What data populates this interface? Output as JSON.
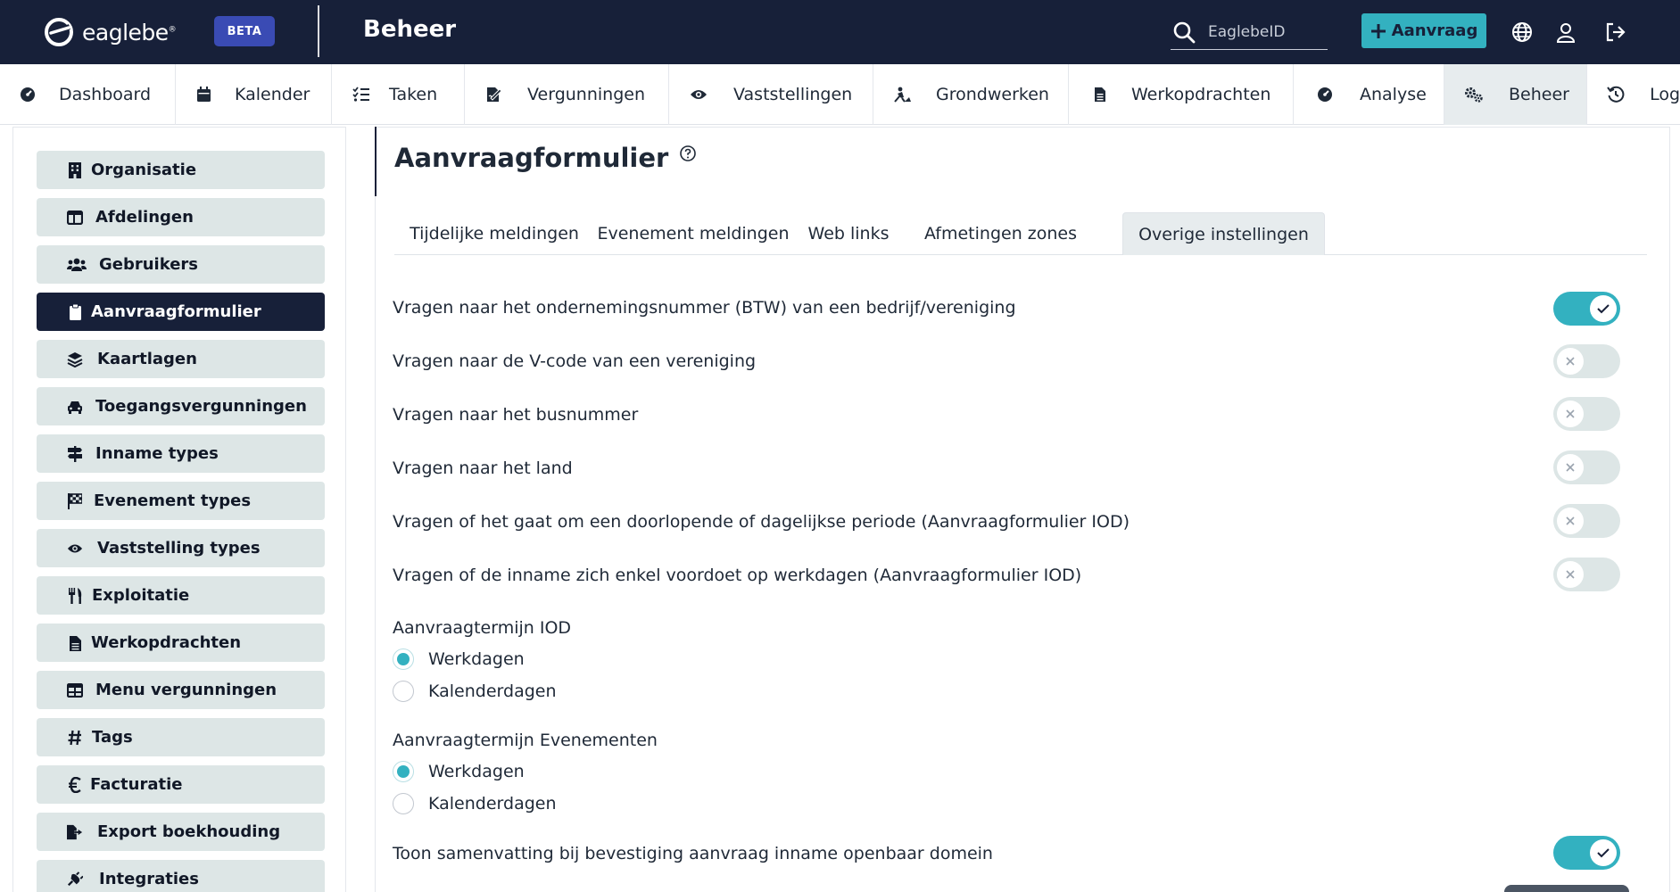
{
  "header": {
    "brand": "eaglebe",
    "brand_mark": "®",
    "beta_badge": "BETA",
    "section_title": "Beheer",
    "search_placeholder": "EaglebeID",
    "new_request_label": "Aanvraag"
  },
  "nav": {
    "items": [
      {
        "label": "Dashboard",
        "icon": "gauge-icon"
      },
      {
        "label": "Kalender",
        "icon": "calendar-icon"
      },
      {
        "label": "Taken",
        "icon": "tasks-icon"
      },
      {
        "label": "Vergunningen",
        "icon": "signature-icon"
      },
      {
        "label": "Vaststellingen",
        "icon": "eye-icon"
      },
      {
        "label": "Grondwerken",
        "icon": "digging-icon"
      },
      {
        "label": "Werkopdrachten",
        "icon": "file-icon"
      },
      {
        "label": "Analyse",
        "icon": "gauge-icon"
      },
      {
        "label": "Beheer",
        "icon": "gears-icon"
      },
      {
        "label": "Log",
        "icon": "history-icon"
      }
    ],
    "active": "Beheer"
  },
  "sidebar": {
    "items": [
      {
        "label": "Organisatie",
        "icon": "building-icon"
      },
      {
        "label": "Afdelingen",
        "icon": "window-icon"
      },
      {
        "label": "Gebruikers",
        "icon": "users-icon"
      },
      {
        "label": "Aanvraagformulier",
        "icon": "clipboard-icon"
      },
      {
        "label": "Kaartlagen",
        "icon": "layers-icon"
      },
      {
        "label": "Toegangsvergunningen",
        "icon": "car-icon"
      },
      {
        "label": "Inname types",
        "icon": "signs-icon"
      },
      {
        "label": "Evenement types",
        "icon": "flag-icon"
      },
      {
        "label": "Vaststelling types",
        "icon": "eye-icon"
      },
      {
        "label": "Exploitatie",
        "icon": "utensils-icon"
      },
      {
        "label": "Werkopdrachten",
        "icon": "file-icon"
      },
      {
        "label": "Menu vergunningen",
        "icon": "table-icon"
      },
      {
        "label": "Tags",
        "icon": "hashtag-icon"
      },
      {
        "label": "Facturatie",
        "icon": "euro-icon"
      },
      {
        "label": "Export boekhouding",
        "icon": "export-icon"
      },
      {
        "label": "Integraties",
        "icon": "plug-icon"
      }
    ],
    "active": "Aanvraagformulier"
  },
  "main": {
    "title": "Aanvraagformulier",
    "tabs": [
      {
        "label": "Tijdelijke meldingen"
      },
      {
        "label": "Evenement meldingen"
      },
      {
        "label": "Web links"
      },
      {
        "label": "Afmetingen zones"
      },
      {
        "label": "Overige instellingen"
      }
    ],
    "active_tab": "Overige instellingen",
    "settings": [
      {
        "label": "Vragen naar het ondernemingsnummer (BTW) van een bedrijf/vereniging",
        "enabled": true
      },
      {
        "label": "Vragen naar de V-code van een vereniging",
        "enabled": false
      },
      {
        "label": "Vragen naar het busnummer",
        "enabled": false
      },
      {
        "label": "Vragen naar het land",
        "enabled": false
      },
      {
        "label": "Vragen of het gaat om een doorlopende of dagelijkse periode (Aanvraagformulier IOD)",
        "enabled": false
      },
      {
        "label": "Vragen of de inname zich enkel voordoet op werkdagen (Aanvraagformulier IOD)",
        "enabled": false
      }
    ],
    "term_iod": {
      "label": "Aanvraagtermijn IOD",
      "options": [
        "Werkdagen",
        "Kalenderdagen"
      ],
      "selected": "Werkdagen"
    },
    "term_events": {
      "label": "Aanvraagtermijn Evenementen",
      "options": [
        "Werkdagen",
        "Kalenderdagen"
      ],
      "selected": "Werkdagen"
    },
    "summary_setting": {
      "label": "Toon samenvatting bij bevestiging aanvraag inname openbaar domein",
      "enabled": true
    }
  },
  "colors": {
    "header_bg": "#172039",
    "accent": "#33b1c0",
    "beta_bg": "#3a4bb4",
    "sidebar_item_bg": "#dde6e6",
    "active_tab_bg": "#e7ecee"
  }
}
